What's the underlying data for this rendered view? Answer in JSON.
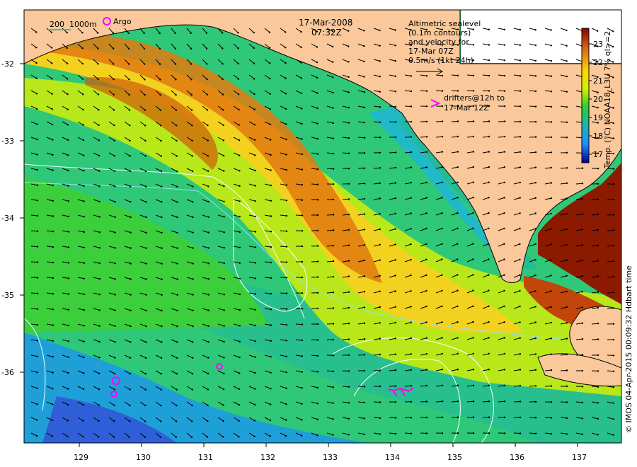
{
  "header": {
    "date": "17-Mar-2008",
    "time": "07:32Z",
    "scale_legend": "200  1000m",
    "argo_label": "Argo"
  },
  "sealevel_note": {
    "lines": [
      "Altimetric sealevel",
      "(0.1m contours)",
      "and velocity for",
      "17-Mar 07Z",
      "0.5m/s (1kt 24h)"
    ]
  },
  "drifters_note": {
    "lines": [
      "drifters@12h to",
      "17-Mar 12Z"
    ],
    "color": "#ff00ff"
  },
  "colorbar": {
    "label": "Temp. (°C) NOAA18_L3U 7% ql>=2",
    "ticks": [
      "23",
      "22",
      "21",
      "20",
      "19",
      "18",
      "17"
    ],
    "colors": [
      "#8b0000",
      "#d2691e",
      "#ffd700",
      "#d4f000",
      "#32cd32",
      "#20b2aa",
      "#1e90ff",
      "#00008b"
    ]
  },
  "axes": {
    "x_ticks": [
      "129",
      "130",
      "131",
      "132",
      "133",
      "134",
      "135",
      "136",
      "137"
    ],
    "y_ticks": [
      "-32",
      "-33",
      "-34",
      "-35",
      "-36"
    ]
  },
  "credit": "© IMOS 04-Apr-2015 00:09:32 Hdbart time",
  "palette": {
    "land": "#fac89a",
    "warm_dark": "#8b1a00",
    "orange": "#e07a10",
    "yellow": "#f2d21e",
    "lime": "#b8e81a",
    "green": "#3ccf3c",
    "teal": "#23b99b",
    "cyan": "#1eb4dc",
    "blue": "#2f5fd8"
  }
}
